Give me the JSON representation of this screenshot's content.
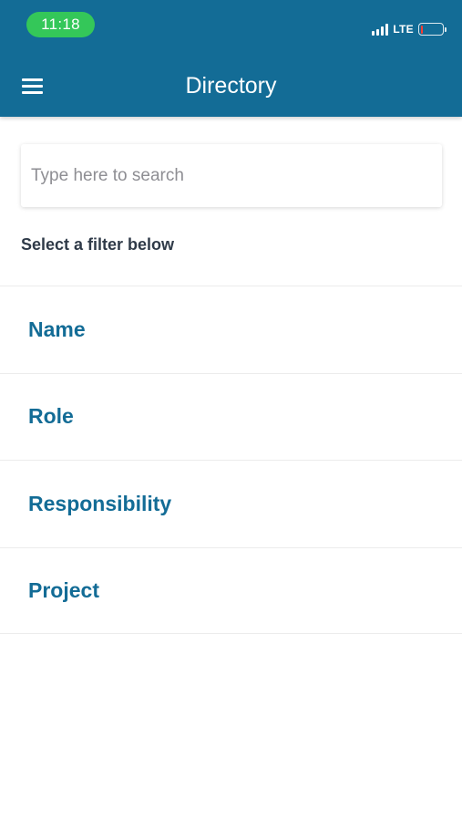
{
  "status_bar": {
    "time": "11:18",
    "network": "LTE",
    "battery_level_percent": 10,
    "colors": {
      "time_pill": "#34c759",
      "battery_low": "#ff3b30"
    }
  },
  "nav": {
    "title": "Directory",
    "menu_icon": "hamburger-menu-icon",
    "background": "#136c96"
  },
  "search": {
    "placeholder": "Type here to search",
    "value": ""
  },
  "filter_section": {
    "heading": "Select a filter below",
    "items": [
      {
        "label": "Name"
      },
      {
        "label": "Role"
      },
      {
        "label": "Responsibility"
      },
      {
        "label": "Project"
      }
    ]
  }
}
